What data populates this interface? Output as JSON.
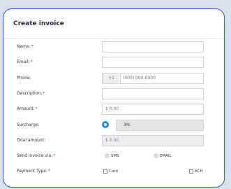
{
  "form": {
    "title": "Create invoice",
    "required_marker": "*",
    "name": {
      "label": "Name:",
      "value": ""
    },
    "email": {
      "label": "Email:",
      "value": ""
    },
    "phone": {
      "label": "Phone:",
      "country_code": "+1",
      "placeholder": "(000) 000-0000"
    },
    "description": {
      "label": "Description:",
      "value": ""
    },
    "amount": {
      "label": "Amount:",
      "value": "$ 0.00"
    },
    "surcharge": {
      "label": "Surcharge:",
      "value": "3%",
      "enabled": true
    },
    "total": {
      "label": "Total amount:",
      "value": "$ 0.00"
    },
    "send_via": {
      "label": "Send invoice via:",
      "options": [
        "SMS",
        "EMAIL"
      ]
    },
    "payment_type": {
      "label": "Payment Type:",
      "options": [
        "Card",
        "ACH"
      ]
    }
  },
  "colors": {
    "accent": "#1e88d6",
    "border": "#1e5bb0",
    "required": "#e0301e"
  }
}
